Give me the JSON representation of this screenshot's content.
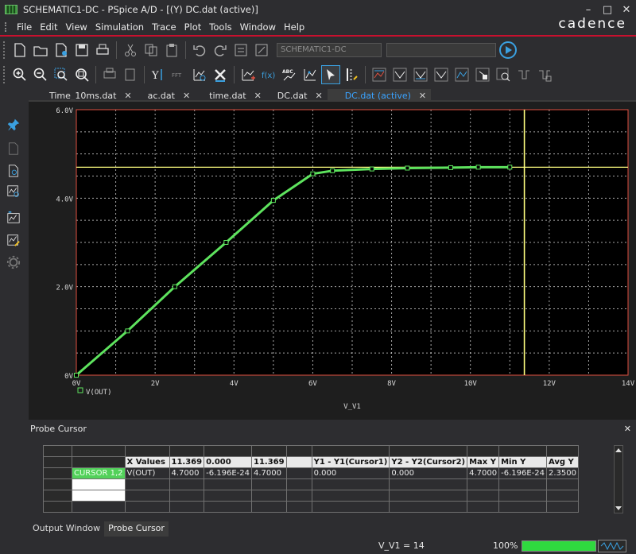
{
  "window": {
    "title": "SCHEMATIC1-DC - PSpice A/D  - [(Y) DC.dat (active)]",
    "brand": "cadence",
    "controls": [
      "–",
      "□",
      "✕"
    ]
  },
  "menu": [
    "File",
    "Edit",
    "View",
    "Simulation",
    "Trace",
    "Plot",
    "Tools",
    "Window",
    "Help"
  ],
  "toolbar1": {
    "profile_combo": "SCHEMATIC1-DC",
    "secondary_combo": "",
    "icons": [
      "new-icon",
      "open-icon",
      "new-folder-icon",
      "save-icon",
      "print-icon",
      "cut-icon",
      "copy-icon",
      "paste-icon",
      "undo-icon",
      "redo-icon",
      "simulation-profile-icon",
      "edit-profile-icon"
    ]
  },
  "toolbar2": {
    "icons": [
      "zoom-in-icon",
      "zoom-out-icon",
      "zoom-area-icon",
      "zoom-fit-icon",
      "copy-plot-icon",
      "log-x-icon",
      "fft-icon",
      "performance-icon",
      "eval-measurement-icon",
      "add-trace-icon",
      "add-plot-icon",
      "text-label-icon",
      "mark-data-icon",
      "select-icon",
      "toggle-cursor-icon",
      "cursor-peak-icon",
      "cursor-trough-icon",
      "cursor-slope-icon",
      "cursor-min-icon",
      "cursor-max-icon",
      "cursor-point-icon",
      "cursor-search-icon",
      "cursor-next-transition-icon",
      "cursor-prev-transition-icon",
      "mark-label-icon"
    ],
    "fft_label": "FFT"
  },
  "tabs": [
    {
      "label": "Time_10ms.dat",
      "close": "✕"
    },
    {
      "label": "ac.dat",
      "close": "✕"
    },
    {
      "label": "time.dat",
      "close": "✕"
    },
    {
      "label": "DC.dat",
      "close": "✕"
    },
    {
      "label": "DC.dat (active)",
      "close": "✕",
      "active": true
    }
  ],
  "chart_data": {
    "type": "line",
    "xlabel": "V_V1",
    "xlim": [
      0,
      14
    ],
    "ylim": [
      0,
      6
    ],
    "x_ticks": [
      "0V",
      "2V",
      "4V",
      "6V",
      "8V",
      "10V",
      "12V",
      "14V"
    ],
    "y_ticks": [
      "0V",
      "2.0V",
      "4.0V",
      "6.0V"
    ],
    "grid": true,
    "legend": "bottom-left",
    "series": [
      {
        "name": "V(OUT)",
        "color": "#5ee35e",
        "x": [
          0,
          1.3,
          2.5,
          3.8,
          5.0,
          6.0,
          6.5,
          7.5,
          8.4,
          9.5,
          10.2,
          11.0
        ],
        "y": [
          0,
          1.0,
          2.0,
          3.0,
          3.95,
          4.55,
          4.62,
          4.66,
          4.68,
          4.69,
          4.7,
          4.7
        ]
      }
    ],
    "cursor": {
      "x": 11.369,
      "y": 4.7,
      "horizontal_color": "#ffff80",
      "vertical_color": "#ffff80"
    },
    "background": "#000000",
    "grid_color": "#ffffff",
    "frame_color": "#e05040"
  },
  "probe_cursor": {
    "title": "Probe Cursor",
    "close": "✕",
    "headers": [
      "X Values",
      "11.369",
      "0.000",
      "11.369",
      "",
      "Y1 - Y1(Cursor1)",
      "Y2 - Y2(Cursor2)",
      "Max Y",
      "Min Y",
      "Avg Y"
    ],
    "row": {
      "cursor_label": "CURSOR 1,2",
      "trace": "V(OUT)",
      "values": [
        "4.7000",
        "-6.196E-24",
        "4.7000",
        "",
        "0.000",
        "0.000",
        "4.7000",
        "-6.196E-24",
        "2.3500"
      ]
    }
  },
  "bottom_tabs": [
    "Output Window",
    "Probe Cursor"
  ],
  "status": {
    "variable": "V_V1  =  14",
    "zoom": "100%",
    "progress": 1.0
  }
}
